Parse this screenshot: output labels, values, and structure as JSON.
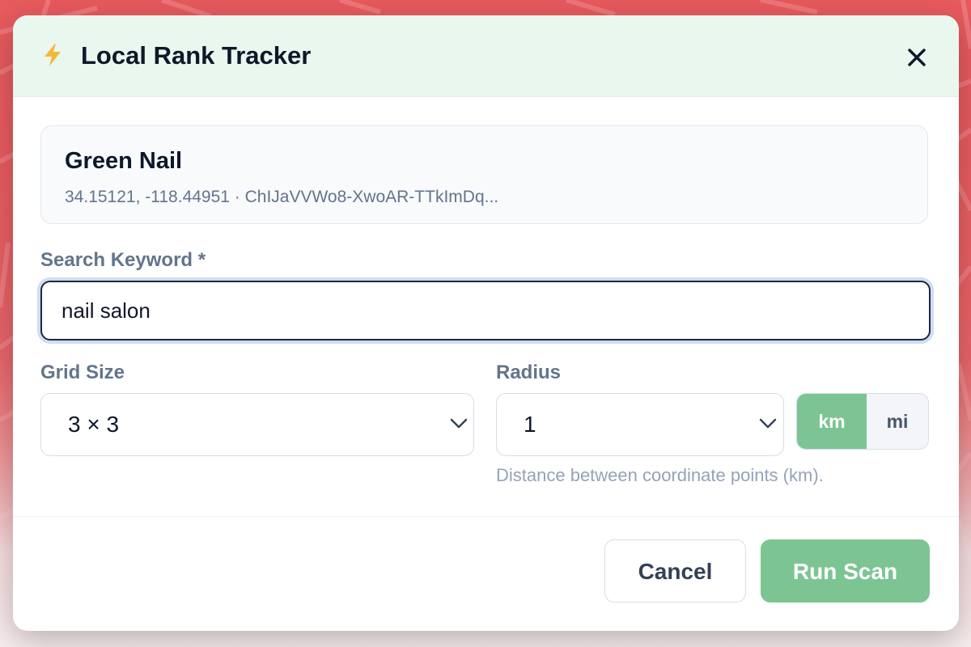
{
  "header": {
    "title": "Local Rank Tracker"
  },
  "business": {
    "name": "Green Nail",
    "meta": "34.15121, -118.44951 · ChIJaVVWo8-XwoAR-TTkImDq..."
  },
  "keyword": {
    "label": "Search Keyword *",
    "value": "nail salon"
  },
  "grid_size": {
    "label": "Grid Size",
    "value": "3 × 3"
  },
  "radius": {
    "label": "Radius",
    "value": "1",
    "units": [
      "km",
      "mi"
    ],
    "selected_unit": "km",
    "help": "Distance between coordinate points (km)."
  },
  "footer": {
    "cancel_label": "Cancel",
    "run_label": "Run Scan"
  },
  "colors": {
    "header_bg": "#e9f7ee",
    "accent_green": "#7cc592",
    "background_red": "#e85a5e",
    "bolt": "#f5b73b"
  }
}
